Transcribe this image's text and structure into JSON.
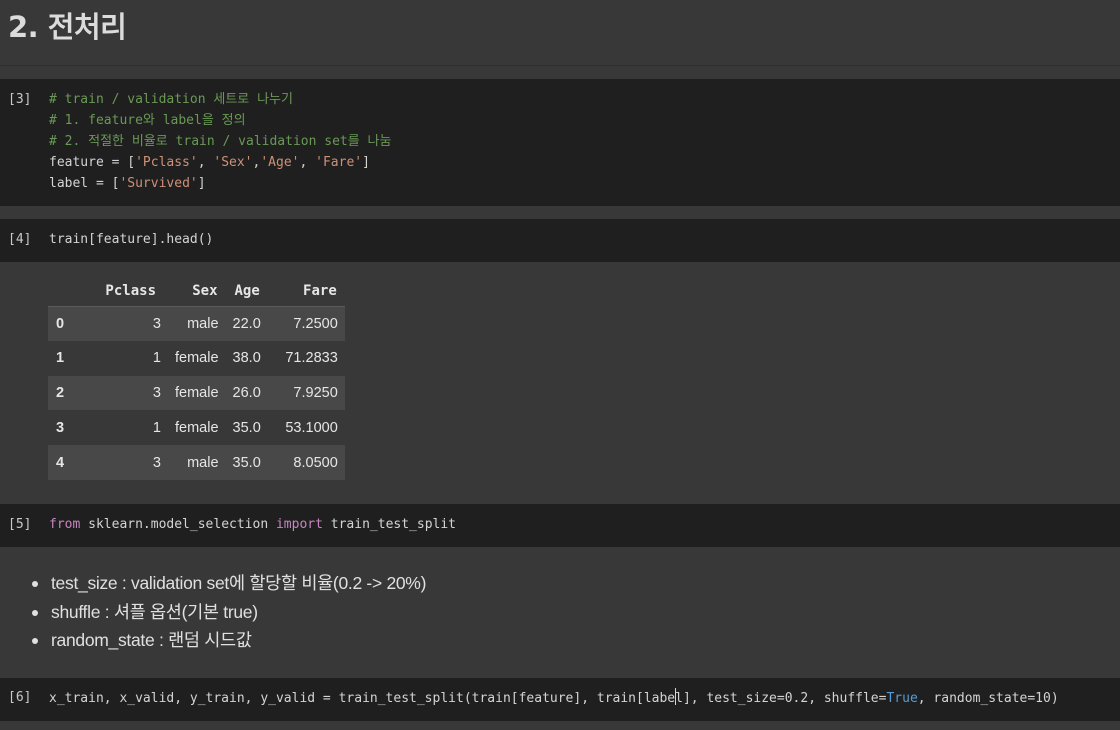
{
  "heading": "2. 전처리",
  "cells": {
    "cell3": {
      "prompt": "[3]",
      "lines": [
        "# train / validation 세트로 나누기",
        "# 1. feature와 label을 정의",
        "# 2. 적절한 비율로 train / validation set를 나눔"
      ],
      "feature_var": "feature = [",
      "feature_items": [
        "'Pclass'",
        "'Sex'",
        "'Age'",
        "'Fare'"
      ],
      "label_var": "label = [",
      "label_items": [
        "'Survived'"
      ]
    },
    "cell4": {
      "prompt": "[4]",
      "code": "train[feature].head()",
      "table": {
        "columns": [
          "",
          "Pclass",
          "Sex",
          "Age",
          "Fare"
        ],
        "rows": [
          [
            "0",
            "3",
            "male",
            "22.0",
            "7.2500"
          ],
          [
            "1",
            "1",
            "female",
            "38.0",
            "71.2833"
          ],
          [
            "2",
            "3",
            "female",
            "26.0",
            "7.9250"
          ],
          [
            "3",
            "1",
            "female",
            "35.0",
            "53.1000"
          ],
          [
            "4",
            "3",
            "male",
            "35.0",
            "8.0500"
          ]
        ]
      }
    },
    "cell5": {
      "prompt": "[5]",
      "kw_from": "from",
      "module": " sklearn.model_selection ",
      "kw_import": "import",
      "name": " train_test_split"
    },
    "markdown": {
      "bullets": [
        "test_size : validation set에 할당할 비율(0.2 -> 20%)",
        "shuffle : 셔플 옵션(기본 true)",
        "random_state : 랜덤 시드값"
      ]
    },
    "cell6": {
      "prompt": "[6]",
      "code_a": "x_train, x_valid, y_train, y_valid = train_test_split(train[feature], train[labe",
      "code_b": "l], test_size=0.2, shuffle=",
      "const": "True",
      "code_c": ", random_state=10)"
    }
  }
}
